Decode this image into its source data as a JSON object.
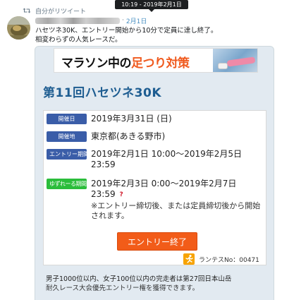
{
  "tooltip": {
    "text": "10:19 - 2019年2月1日"
  },
  "retweet": {
    "icon": "retweet-icon",
    "label": "自分がリツイート"
  },
  "tweet": {
    "date": "2月1日",
    "separator": "·",
    "lines": [
      "ハセツネ30K、エントリー開始から10分で定員に達し終了。",
      "相変わらずの人気レースだ。"
    ]
  },
  "card": {
    "banner": {
      "part1": "マラソン中の",
      "part2": "足つり対策"
    },
    "title": "第11回ハセツネ30K",
    "rows": [
      {
        "badge": "開催日",
        "value": "2019年3月31日 (日)"
      },
      {
        "badge": "開催地",
        "value": "東京都(あきる野市)"
      },
      {
        "badge": "エントリー期間",
        "value": "2019年2月1日 10:00〜2019年2月5日 23:59"
      },
      {
        "badge": "ゆずれーる期間",
        "value": "2019年2月3日 0:00〜2019年2月7日 23:59",
        "help": "?",
        "note": "※エントリー締切後、または定員締切後から開始されます。"
      }
    ],
    "entry_button": "エントリー終了",
    "runtes_label": "ランテスNo：00471",
    "description_lines": [
      "男子1000位以内、女子100位以内の完走者は第27回日本山岳",
      "耐久レース大会優先エントリー権を獲得できます。"
    ]
  },
  "colors": {
    "title_blue": "#1e5d91",
    "badge_blue": "#3a5da8",
    "badge_green": "#2bbd3b",
    "button_orange": "#f25c19",
    "banner_orange": "#f05a1e",
    "link_blue": "#4a90c2"
  }
}
